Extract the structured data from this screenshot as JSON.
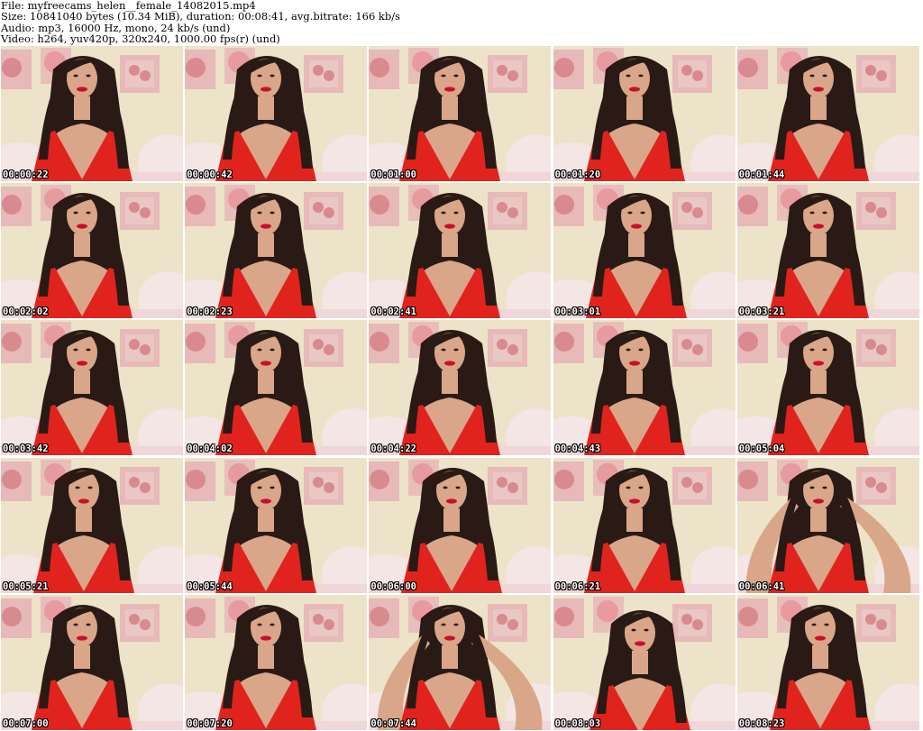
{
  "header": {
    "file": "File: myfreecams_helen__female_14082015.mp4",
    "size": "Size: 10841040 bytes (10.34 MiB), duration: 00:08:41, avg.bitrate: 166 kb/s",
    "audio": "Audio: mp3, 16000 Hz, mono, 24 kb/s (und)",
    "video": "Video: h264, yuv420p, 320x240, 1000.00 fps(r) (und)"
  },
  "thumbnails": [
    {
      "timestamp": "00:00:22",
      "pose": "neutral"
    },
    {
      "timestamp": "00:00:42",
      "pose": "neutral"
    },
    {
      "timestamp": "00:01:00",
      "pose": "neutral"
    },
    {
      "timestamp": "00:01:20",
      "pose": "neutral"
    },
    {
      "timestamp": "00:01:44",
      "pose": "neutral"
    },
    {
      "timestamp": "00:02:02",
      "pose": "neutral"
    },
    {
      "timestamp": "00:02:23",
      "pose": "neutral"
    },
    {
      "timestamp": "00:02:41",
      "pose": "neutral"
    },
    {
      "timestamp": "00:03:01",
      "pose": "tilt"
    },
    {
      "timestamp": "00:03:21",
      "pose": "neutral"
    },
    {
      "timestamp": "00:03:42",
      "pose": "neutral"
    },
    {
      "timestamp": "00:04:02",
      "pose": "neutral"
    },
    {
      "timestamp": "00:04:22",
      "pose": "neutral"
    },
    {
      "timestamp": "00:04:43",
      "pose": "neutral"
    },
    {
      "timestamp": "00:05:04",
      "pose": "neutral"
    },
    {
      "timestamp": "00:05:21",
      "pose": "tilt"
    },
    {
      "timestamp": "00:05:44",
      "pose": "neutral"
    },
    {
      "timestamp": "00:06:00",
      "pose": "tilt"
    },
    {
      "timestamp": "00:06:21",
      "pose": "neutral"
    },
    {
      "timestamp": "00:06:41",
      "pose": "arms-up"
    },
    {
      "timestamp": "00:07:00",
      "pose": "neutral"
    },
    {
      "timestamp": "00:07:20",
      "pose": "neutral"
    },
    {
      "timestamp": "00:07:44",
      "pose": "arms-up"
    },
    {
      "timestamp": "00:08:03",
      "pose": "down"
    },
    {
      "timestamp": "00:08:23",
      "pose": "tilt"
    }
  ],
  "colors": {
    "wall": "#ece3c8",
    "pillow": "#f3e6e4",
    "frame_pink": "#e7b4b6",
    "frame_inner": "#d98a8f",
    "hair": "#2a1a15",
    "skin": "#d9a689",
    "dress": "#e1231d",
    "lips": "#c8102a"
  }
}
